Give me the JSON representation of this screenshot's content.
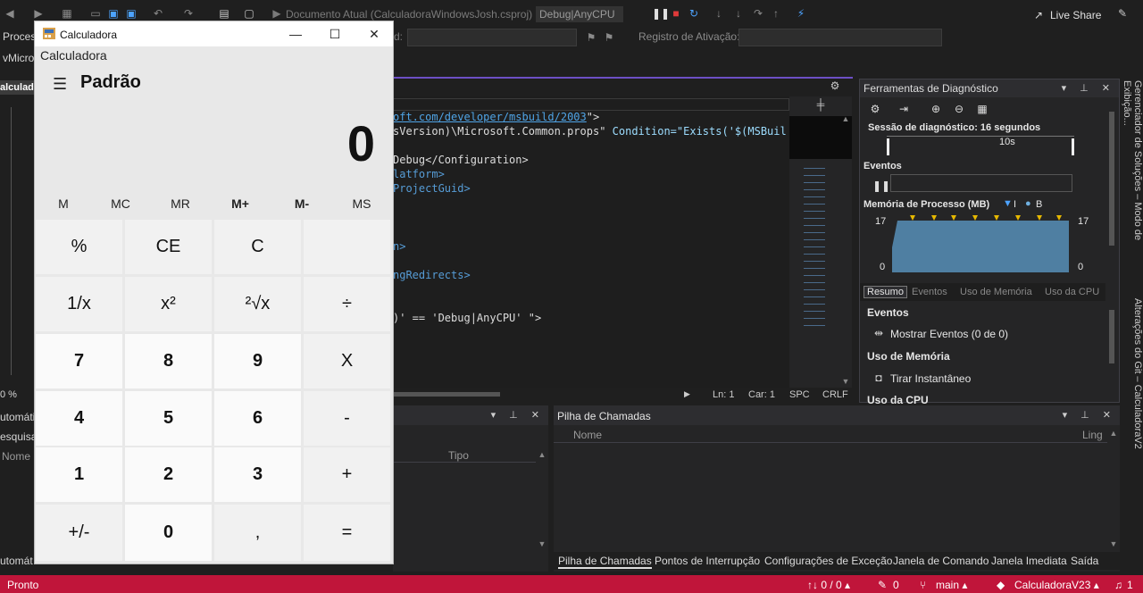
{
  "ide": {
    "toolbar": {
      "run_target": "Documento Atual (CalculadoraWindowsJosh.csproj)",
      "config": "Debug|AnyCPU",
      "live_share": "Live Share"
    },
    "row2": {
      "process_label": "Proces",
      "activation_log_label": "Registro de Ativação:",
      "colon": "d:"
    },
    "left_stub": {
      "ms": "vMicro",
      "tab": "alculado",
      "zoom": "0 %",
      "auto": "utomáti",
      "search": "esquisa",
      "name": "Nome",
      "auto_bottom": "utomát"
    },
    "editor": {
      "lines": [
        {
          "t": "oft.com/developer/msbuild/2003",
          "k": "link",
          "tail": "\">"
        },
        {
          "t": "sVersion)\\Microsoft.Common.props\"",
          "k": "white",
          "tail": " Condition=\"Exists('$(MSBuil"
        },
        {
          "t": "Debug</Configuration>",
          "k": "mix1",
          "tail": ""
        },
        {
          "t": "latform>",
          "k": "blue",
          "tail": ""
        },
        {
          "t": "ProjectGuid>",
          "k": "blue",
          "tail": ""
        },
        {
          "t": "n>",
          "k": "blue",
          "tail": ""
        },
        {
          "t": "ngRedirects>",
          "k": "blue",
          "tail": ""
        },
        {
          "t": ")' == 'Debug|AnyCPU' \">",
          "k": "white",
          "tail": ""
        }
      ],
      "status": {
        "line": "Ln: 1",
        "char": "Car: 1",
        "spc": "SPC",
        "crlf": "CRLF"
      }
    },
    "diagnostics": {
      "title": "Ferramentas de Diagnóstico",
      "session": "Sessão de diagnóstico: 16 segundos",
      "timeline_tick": "10s",
      "events_header": "Eventos",
      "memory_header": "Memória de Processo (MB)",
      "memory_legend_a": "I",
      "memory_legend_b": "B",
      "mem_max_left": "17",
      "mem_max_right": "17",
      "mem_min_left": "0",
      "mem_min_right": "0",
      "tabs": [
        "Resumo",
        "Eventos",
        "Uso de Memória",
        "Uso da CPU"
      ],
      "section_events": "Eventos",
      "show_events": "Mostrar Eventos (0 de 0)",
      "section_memory": "Uso de Memória",
      "snapshot": "Tirar Instantâneo",
      "section_cpu": "Uso da CPU"
    },
    "side_tabs": {
      "solution": "Gerenciador de Soluções – Modo de Exibição...",
      "git": "Alterações do Git – CalculadoraV2"
    },
    "auto_panel": {
      "col_type": "Tipo"
    },
    "callstack": {
      "title": "Pilha de Chamadas",
      "col_name": "Nome",
      "col_lang": "Ling"
    },
    "bottom_tabs": [
      "Pilha de Chamadas",
      "Pontos de Interrupção",
      "Configurações de Exceção",
      "Janela de Comando",
      "Janela Imediata",
      "Saída"
    ],
    "statusbar": {
      "ready": "Pronto",
      "changes": "↑↓ 0 / 0 ▴",
      "pencil": "0",
      "branch": "main ▴",
      "repo": "CalculadoraV23 ▴",
      "notif": "1"
    }
  },
  "calculator": {
    "window_title": "Calculadora",
    "app_name": "Calculadora",
    "mode": "Padrão",
    "display": "0",
    "memory": [
      "M",
      "MC",
      "MR",
      "M+",
      "M-",
      "MS"
    ],
    "keys": [
      [
        "%",
        "CE",
        "C",
        ""
      ],
      [
        "1/x",
        "x²",
        "²√x",
        "÷"
      ],
      [
        "7",
        "8",
        "9",
        "X"
      ],
      [
        "4",
        "5",
        "6",
        "-"
      ],
      [
        "1",
        "2",
        "3",
        "+"
      ],
      [
        "+/-",
        "0",
        ",",
        "="
      ]
    ]
  },
  "colors": {
    "statusbar": "#c0153a",
    "accent": "#6c4fc5",
    "chart_fill": "#4f7fa2"
  }
}
